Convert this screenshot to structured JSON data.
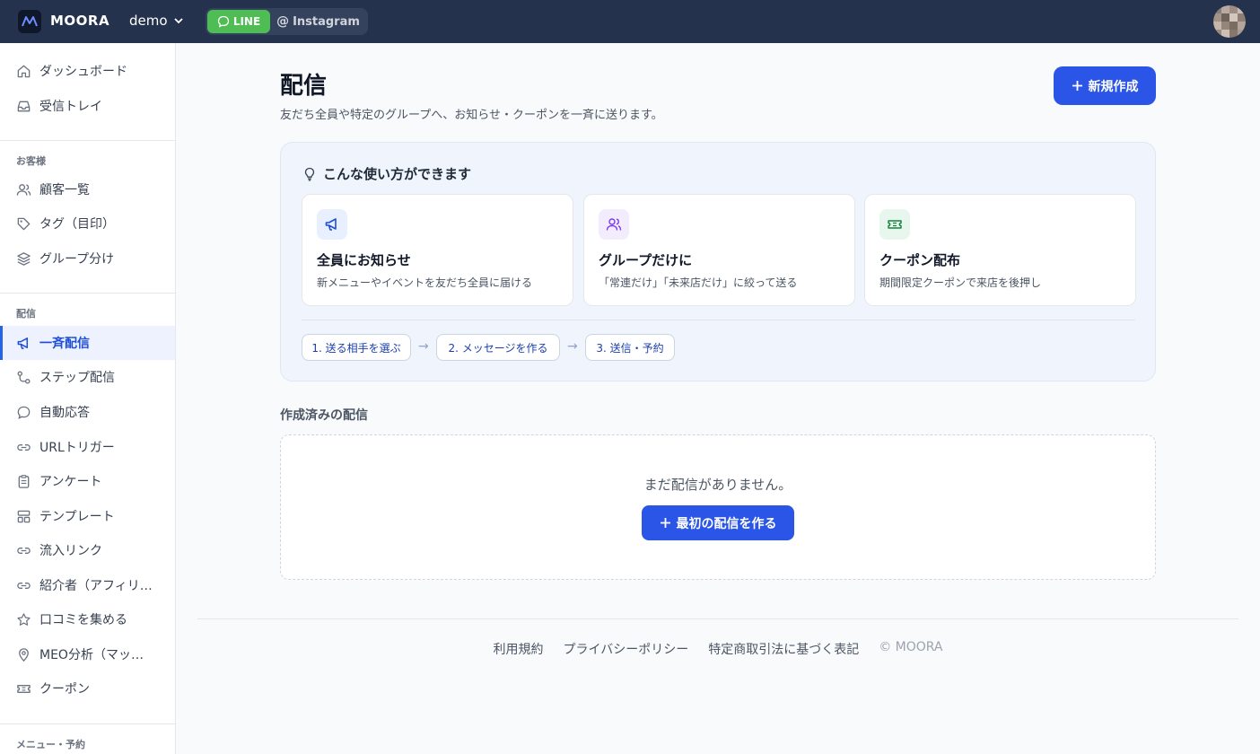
{
  "topbar": {
    "brand": "MOORA",
    "workspace": "demo",
    "channels": {
      "line": "LINE",
      "instagram": "Instagram"
    }
  },
  "sidebar": {
    "top_items": [
      {
        "label": "ダッシュボード",
        "icon": "home-icon"
      },
      {
        "label": "受信トレイ",
        "icon": "inbox-icon"
      }
    ],
    "section_customers": "お客様",
    "customer_items": [
      {
        "label": "顧客一覧",
        "icon": "users-icon"
      },
      {
        "label": "タグ（目印）",
        "icon": "tag-icon"
      },
      {
        "label": "グループ分け",
        "icon": "layers-icon"
      }
    ],
    "section_delivery": "配信",
    "delivery_items": [
      {
        "label": "一斉配信",
        "icon": "megaphone-icon",
        "active": true
      },
      {
        "label": "ステップ配信",
        "icon": "step-icon"
      },
      {
        "label": "自動応答",
        "icon": "chat-icon"
      },
      {
        "label": "URLトリガー",
        "icon": "link-icon"
      },
      {
        "label": "アンケート",
        "icon": "clipboard-icon"
      },
      {
        "label": "テンプレート",
        "icon": "template-icon"
      },
      {
        "label": "流入リンク",
        "icon": "link-icon"
      },
      {
        "label": "紹介者（アフィリエイト）",
        "icon": "link-icon"
      },
      {
        "label": "口コミを集める",
        "icon": "star-icon"
      },
      {
        "label": "MEO分析（マップ検索）",
        "icon": "map-pin-icon"
      },
      {
        "label": "クーポン",
        "icon": "ticket-icon"
      }
    ],
    "section_menu": "メニュー・予約"
  },
  "main": {
    "title": "配信",
    "subtitle": "友だち全員や特定のグループへ、お知らせ・クーポンを一斉に送ります。",
    "new_button": "新規作成",
    "tips": {
      "title": "こんな使い方ができます",
      "cards": [
        {
          "title": "全員にお知らせ",
          "desc": "新メニューやイベントを友だち全員に届ける"
        },
        {
          "title": "グループだけに",
          "desc": "「常連だけ」「未来店だけ」に絞って送る"
        },
        {
          "title": "クーポン配布",
          "desc": "期間限定クーポンで来店を後押し"
        }
      ],
      "steps": [
        "1. 送る相手を選ぶ",
        "2. メッセージを作る",
        "3. 送信・予約"
      ]
    },
    "list_title": "作成済みの配信",
    "empty_text": "まだ配信がありません。",
    "first_button": "最初の配信を作る"
  },
  "footer": {
    "links": [
      "利用規約",
      "プライバシーポリシー",
      "特定商取引法に基づく表記"
    ],
    "copyright": "© MOORA"
  },
  "colors": {
    "topbar": "#25324d",
    "primary": "#2b55e6",
    "line_green": "#4ebd53",
    "active_nav_bg": "#eef2ff"
  }
}
